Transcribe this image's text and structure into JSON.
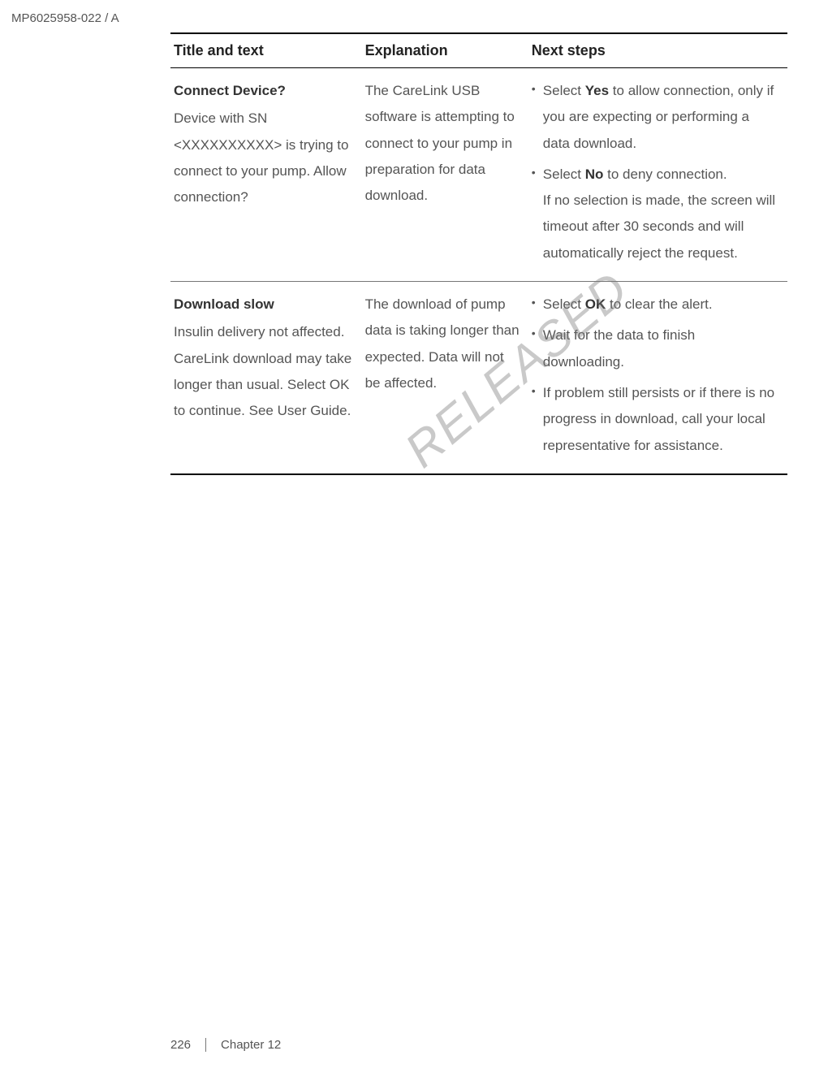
{
  "doc_id": "MP6025958-022 / A",
  "table": {
    "headers": {
      "title_text": "Title and text",
      "explanation": "Explanation",
      "next_steps": "Next steps"
    },
    "rows": [
      {
        "title": "Connect Device?",
        "text": "Device with SN <XXXXXXXXXX> is trying to connect to your pump. Allow connection?",
        "explanation": "The CareLink USB software is attempting to connect to your pump in preparation for data download.",
        "steps": [
          {
            "pre": "Select ",
            "bold": "Yes",
            "post": " to allow connection, only if you are expecting or performing a data download."
          },
          {
            "pre": "Select ",
            "bold": "No",
            "post": " to deny connection.",
            "extra": "If no selection is made, the screen will timeout after 30 seconds and will automatically reject the request."
          }
        ]
      },
      {
        "title": "Download slow",
        "text": "Insulin delivery not affected. CareLink download may take longer than usual. Select OK to continue. See User Guide.",
        "explanation": "The download of pump data is taking longer than expected. Data will not be affected.",
        "steps": [
          {
            "pre": "Select ",
            "bold": "OK",
            "post": " to clear the alert."
          },
          {
            "pre": "Wait for the data to finish downloading.",
            "bold": "",
            "post": ""
          },
          {
            "pre": "If problem still persists or if there is no progress in download, call your local representative for assistance.",
            "bold": "",
            "post": ""
          }
        ]
      }
    ]
  },
  "watermark": "RELEASED",
  "footer": {
    "page": "226",
    "chapter": "Chapter 12"
  }
}
